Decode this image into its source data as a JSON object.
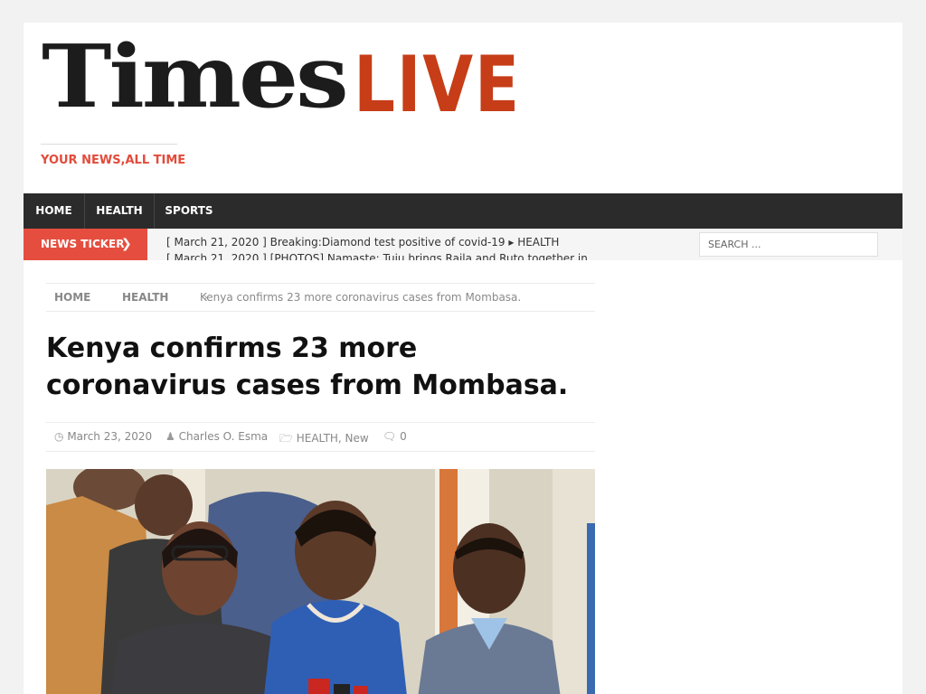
{
  "header": {
    "logo_part1": "Times",
    "logo_part2": "LIVE",
    "tagline": "YOUR NEWS,ALL TIME"
  },
  "nav": {
    "items": [
      {
        "label": "HOME"
      },
      {
        "label": "HEALTH"
      },
      {
        "label": "SPORTS"
      }
    ]
  },
  "ticker": {
    "label": "NEWS TICKER",
    "items": [
      {
        "text": "[ March 21, 2020 ]  Breaking:Diamond test positive of covid-19  ▸  HEALTH"
      },
      {
        "text": "[ March 21, 2020 ]  [PHOTOS] Namaste: Tuju brings Raila and Ruto together in"
      }
    ]
  },
  "search": {
    "placeholder": "SEARCH ..."
  },
  "breadcrumb": {
    "home": "HOME",
    "category": "HEALTH",
    "current": "Kenya confirms 23 more coronavirus cases from Mombasa."
  },
  "post": {
    "title": "Kenya confirms 23 more coronavirus cases from Mombasa.",
    "date": "March 23, 2020",
    "author": "Charles O. Esma",
    "categories": "HEALTH, New",
    "comments": "0"
  },
  "icons": {
    "clock": "clock-icon",
    "user": "user-icon",
    "folder": "folder-icon",
    "comment": "comment-icon",
    "chevron": "chevron-right-icon"
  },
  "colors": {
    "brand_red": "#c63d17",
    "ticker_red": "#e54e3f",
    "nav_bg": "#2b2b2b"
  }
}
